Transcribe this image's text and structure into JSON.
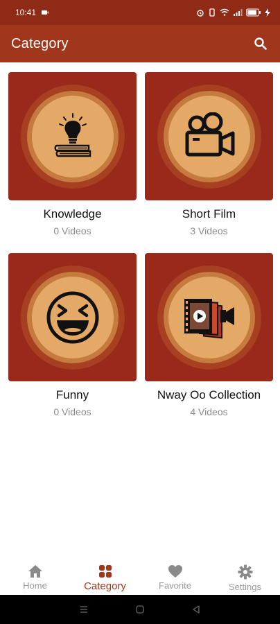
{
  "status_bar": {
    "time": "10:41",
    "battery": "80"
  },
  "app_bar": {
    "title": "Category"
  },
  "categories": [
    {
      "name": "Knowledge",
      "count": "0 Videos",
      "icon": "lightbulb-books-icon"
    },
    {
      "name": "Short Film",
      "count": "3 Videos",
      "icon": "movie-camera-icon"
    },
    {
      "name": "Funny",
      "count": "0 Videos",
      "icon": "laughing-face-icon"
    },
    {
      "name": "Nway Oo Collection",
      "count": "4 Videos",
      "icon": "video-collection-icon"
    }
  ],
  "bottom_nav": {
    "items": [
      {
        "label": "Home",
        "icon": "home-icon",
        "active": false
      },
      {
        "label": "Category",
        "icon": "category-icon",
        "active": true
      },
      {
        "label": "Favorite",
        "icon": "heart-icon",
        "active": false
      },
      {
        "label": "Settings",
        "icon": "gear-icon",
        "active": false
      }
    ]
  },
  "colors": {
    "status_bar": "#8e2a16",
    "app_bar": "#a0361c",
    "card_bg": "#99291a",
    "circle": "#e4a967",
    "active_nav": "#a0361c"
  }
}
